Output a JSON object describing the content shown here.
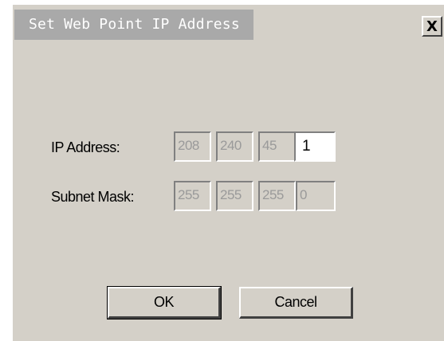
{
  "dialog": {
    "title": "Set Web Point IP Address",
    "close_glyph": "X",
    "close_icon": "close-icon"
  },
  "fields": {
    "ip_label": "IP Address:",
    "ip_octets": [
      "208",
      "240",
      "45",
      "1"
    ],
    "mask_label": "Subnet Mask:",
    "mask_octets": [
      "255",
      "255",
      "255",
      "0"
    ]
  },
  "buttons": {
    "ok_label": "OK",
    "cancel_label": "Cancel"
  },
  "colors": {
    "dialog_bg": "#d4d0c8",
    "title_bar": "#a9a9a9",
    "disabled_text": "#9a9a9a"
  }
}
